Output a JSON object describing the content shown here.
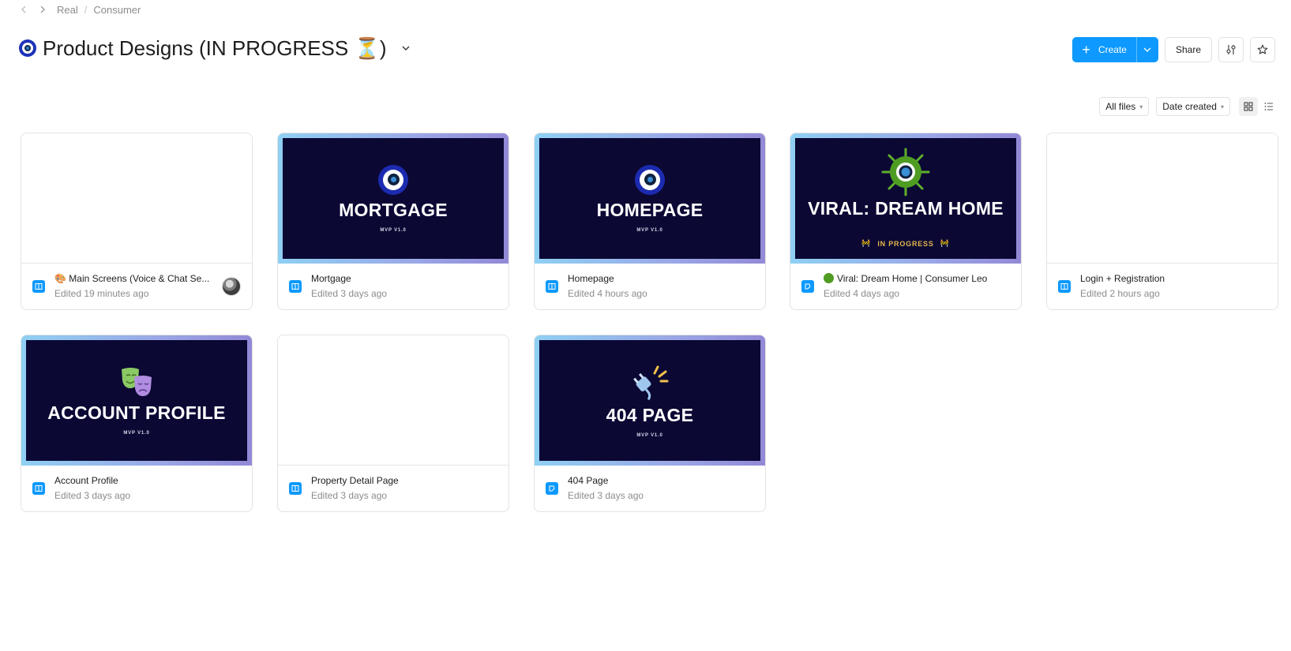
{
  "breadcrumb": {
    "items": [
      "Real",
      "Consumer"
    ],
    "separator": "/"
  },
  "header": {
    "title": "Product Designs (IN PROGRESS ⏳)",
    "create_label": "Create",
    "share_label": "Share"
  },
  "filters": {
    "files_filter": "All files",
    "sort": "Date created",
    "view_mode": "grid"
  },
  "files": [
    {
      "name": "🎨 Main Screens (Voice & Chat Se...",
      "edited": "Edited 19 minutes ago",
      "type": "design",
      "thumb": "blank",
      "has_avatar": true
    },
    {
      "name": "Mortgage",
      "edited": "Edited 3 days ago",
      "type": "design",
      "thumb_title": "MORTGAGE",
      "thumb_sub": "MVP V1.0",
      "thumb_icon": "evil-eye-icon"
    },
    {
      "name": "Homepage",
      "edited": "Edited 4 hours ago",
      "type": "design",
      "thumb_title": "HOMEPAGE",
      "thumb_sub": "MVP V1.0",
      "thumb_icon": "evil-eye-icon"
    },
    {
      "name": "Viral: Dream Home | Consumer Leo",
      "edited": "Edited 4 days ago",
      "type": "figjam",
      "thumb_title": "VIRAL: DREAM HOME",
      "thumb_sub": "IN PROGRESS",
      "thumb_icon": "virus-eye-icon"
    },
    {
      "name": "Login + Registration",
      "edited": "Edited 2 hours ago",
      "type": "design",
      "thumb": "blank"
    },
    {
      "name": "Account Profile",
      "edited": "Edited 3 days ago",
      "type": "design",
      "thumb_title": "ACCOUNT PROFILE",
      "thumb_sub": "MVP V1.0",
      "thumb_icon": "theater-masks-icon"
    },
    {
      "name": "Property Detail Page",
      "edited": "Edited 3 days ago",
      "type": "design",
      "thumb": "blank"
    },
    {
      "name": "404 Page",
      "edited": "Edited 3 days ago",
      "type": "figjam",
      "thumb_title": "404 PAGE",
      "thumb_sub": "MVP V1.0",
      "thumb_icon": "unplugged-icon"
    }
  ],
  "colors": {
    "accent": "#0d99ff",
    "thumb_bg": "#0b0834",
    "progress": "#e3b64a"
  }
}
